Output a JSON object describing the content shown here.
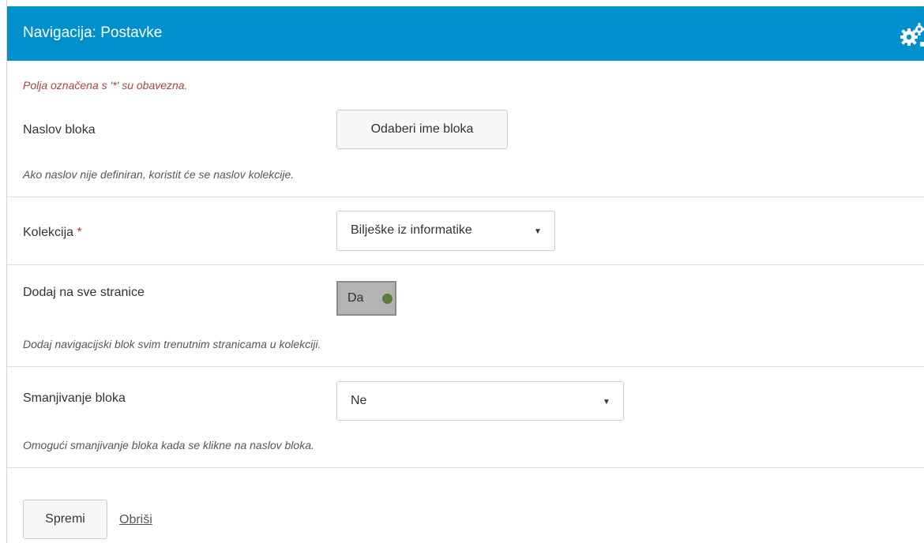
{
  "header": {
    "title": "Navigacija: Postavke",
    "icon": "gears-icon"
  },
  "required_note": "Polja označena s '*' su obavezna.",
  "block_title": {
    "label": "Naslov bloka",
    "button_label": "Odaberi ime bloka",
    "help": "Ako naslov nije definiran, koristit će se naslov kolekcije."
  },
  "collection": {
    "label": "Kolekcija",
    "required_mark": "*",
    "selected": "Bilješke iz informatike",
    "caret": "▼"
  },
  "add_all_pages": {
    "label": "Dodaj na sve stranice",
    "toggle_label": "Da",
    "toggle_on": true,
    "help": "Dodaj navigacijski blok svim trenutnim stranicama u kolekciji."
  },
  "collapse": {
    "label": "Smanjivanje bloka",
    "selected": "Ne",
    "caret": "▼",
    "help": "Omogući smanjivanje bloka kada se klikne na naslov bloka."
  },
  "actions": {
    "save_label": "Spremi",
    "delete_label": "Obriši"
  },
  "colors": {
    "header_bg": "#0091cd",
    "required_text": "#a94442",
    "toggle_dot": "#5c7d3b"
  }
}
